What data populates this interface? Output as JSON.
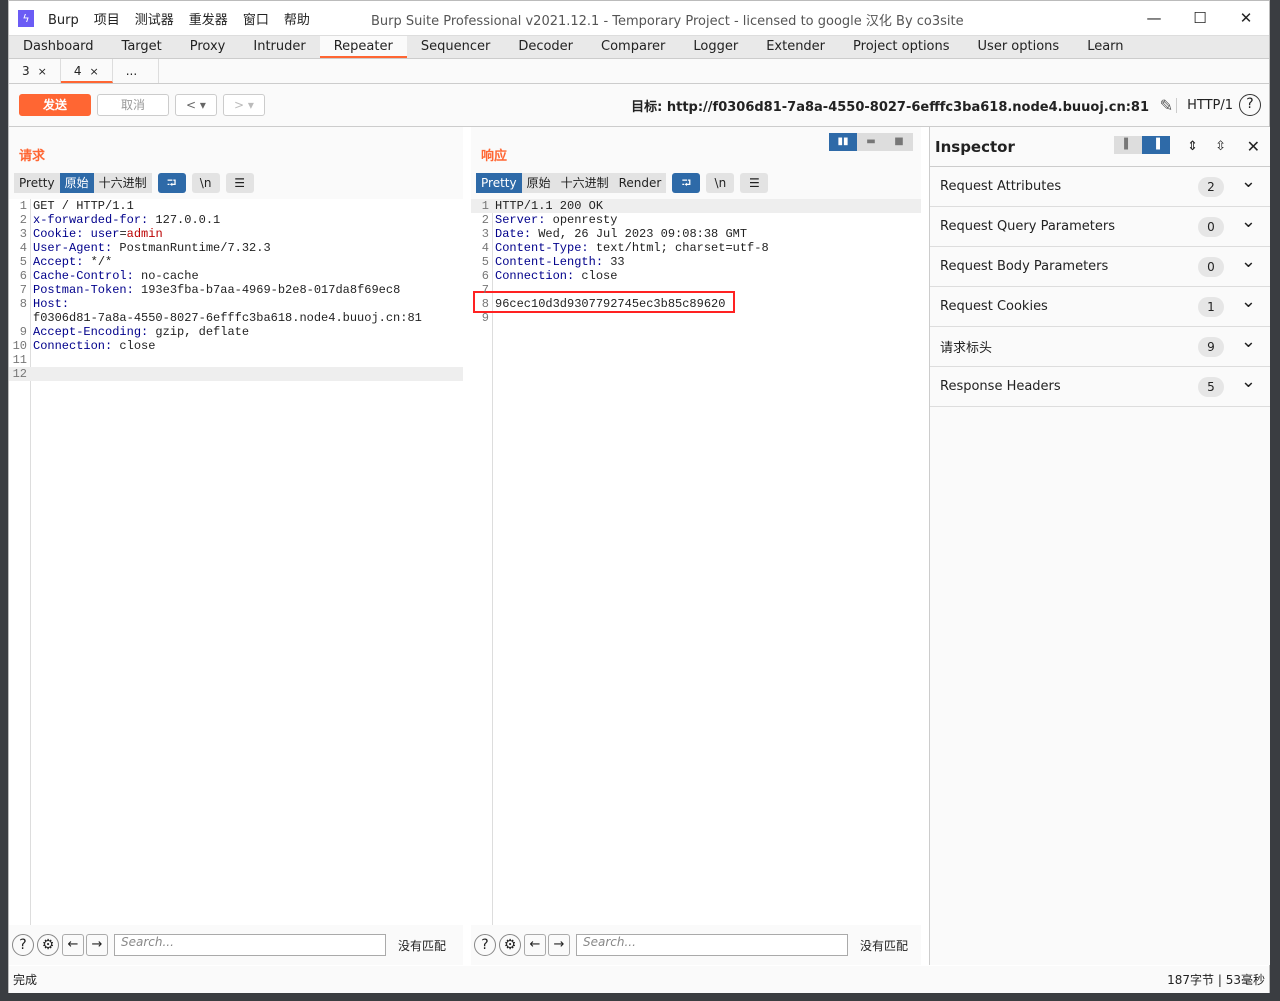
{
  "window": {
    "title": "Burp Suite Professional v2021.12.1 - Temporary Project - licensed to google 汉化 By co3site",
    "menu": [
      "Burp",
      "项目",
      "测试器",
      "重发器",
      "窗口",
      "帮助"
    ]
  },
  "tabs": [
    "Dashboard",
    "Target",
    "Proxy",
    "Intruder",
    "Repeater",
    "Sequencer",
    "Decoder",
    "Comparer",
    "Logger",
    "Extender",
    "Project options",
    "User options",
    "Learn"
  ],
  "active_tab": "Repeater",
  "subtabs": [
    {
      "label": "3",
      "close": "×"
    },
    {
      "label": "4",
      "close": "×"
    },
    {
      "label": "..."
    }
  ],
  "toolbar": {
    "send": "发送",
    "cancel": "取消",
    "target": "目标: http://f0306d81-7a8a-4550-8027-6efffc3ba618.node4.buuoj.cn:81",
    "protocol": "HTTP/1"
  },
  "request": {
    "title": "请求",
    "formats": [
      "Pretty",
      "原始",
      "十六进制"
    ],
    "active_format": "原始",
    "lines": [
      {
        "n": "1",
        "k": "",
        "v": "GET / HTTP/1.1"
      },
      {
        "n": "2",
        "k": "x-forwarded-for",
        "v": " 127.0.0.1"
      },
      {
        "n": "3",
        "k": "Cookie",
        "v": " ",
        "ck": "user",
        "cv": "admin"
      },
      {
        "n": "4",
        "k": "User-Agent",
        "v": " PostmanRuntime/7.32.3"
      },
      {
        "n": "5",
        "k": "Accept",
        "v": " */*"
      },
      {
        "n": "6",
        "k": "Cache-Control",
        "v": " no-cache"
      },
      {
        "n": "7",
        "k": "Postman-Token",
        "v": " 193e3fba-b7aa-4969-b2e8-017da8f69ec8"
      },
      {
        "n": "8",
        "k": "Host",
        "v": ""
      },
      {
        "n": "",
        "k": "",
        "v": "f0306d81-7a8a-4550-8027-6efffc3ba618.node4.buuoj.cn:81"
      },
      {
        "n": "9",
        "k": "Accept-Encoding",
        "v": " gzip, deflate"
      },
      {
        "n": "10",
        "k": "Connection",
        "v": " close"
      },
      {
        "n": "11",
        "k": "",
        "v": ""
      },
      {
        "n": "12",
        "k": "",
        "v": ""
      }
    ],
    "search_placeholder": "Search...",
    "no_match": "没有匹配"
  },
  "response": {
    "title": "响应",
    "formats": [
      "Pretty",
      "原始",
      "十六进制",
      "Render"
    ],
    "active_format": "Pretty",
    "lines": [
      {
        "n": "1",
        "k": "",
        "v": "HTTP/1.1 200 OK"
      },
      {
        "n": "2",
        "k": "Server",
        "v": " openresty"
      },
      {
        "n": "3",
        "k": "Date",
        "v": " Wed, 26 Jul 2023 09:08:38 GMT"
      },
      {
        "n": "4",
        "k": "Content-Type",
        "v": " text/html; charset=utf-8"
      },
      {
        "n": "5",
        "k": "Content-Length",
        "v": " 33"
      },
      {
        "n": "6",
        "k": "Connection",
        "v": " close"
      },
      {
        "n": "7",
        "k": "",
        "v": ""
      },
      {
        "n": "8",
        "k": "",
        "v": "96cec10d3d9307792745ec3b85c89620"
      },
      {
        "n": "9",
        "k": "",
        "v": ""
      }
    ],
    "search_placeholder": "Search...",
    "no_match": "没有匹配"
  },
  "inspector": {
    "title": "Inspector",
    "sections": [
      {
        "label": "Request Attributes",
        "count": "2"
      },
      {
        "label": "Request Query Parameters",
        "count": "0"
      },
      {
        "label": "Request Body Parameters",
        "count": "0"
      },
      {
        "label": "Request Cookies",
        "count": "1"
      },
      {
        "label": "请求标头",
        "count": "9"
      },
      {
        "label": "Response Headers",
        "count": "5"
      }
    ]
  },
  "status": {
    "left": "完成",
    "right": "187字节 | 53毫秒"
  },
  "colors": {
    "accent": "#ff6633",
    "selected": "#2e6aa8",
    "highlight_box": "#ff2222"
  }
}
